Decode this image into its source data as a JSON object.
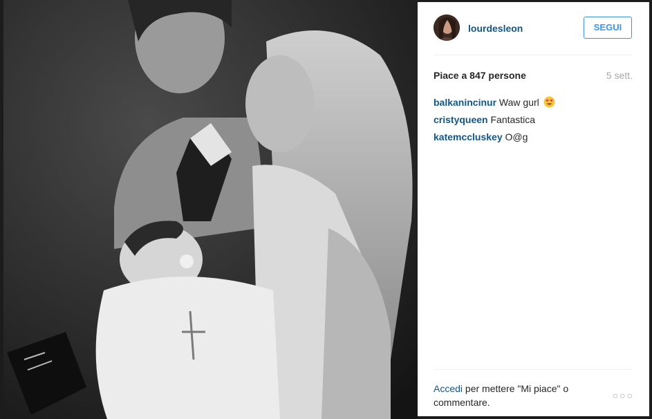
{
  "post": {
    "username": "lourdesleon",
    "follow_label": "SEGUI",
    "likes_text": "Piace a 847 persone",
    "time_ago": "5 sett.",
    "comments": [
      {
        "author": "balkanincinur",
        "text": "Waw gurl"
      },
      {
        "author": "cristyqueen",
        "text": "Fantastica"
      },
      {
        "author": "katemccluskey",
        "text": "O@g"
      }
    ],
    "footer": {
      "login_label": "Accedi",
      "rest_text": "per mettere \"Mi piace\" o commentare."
    },
    "more_label": "○○○"
  },
  "icons": {
    "avatar": "user-avatar",
    "emoji": "heart-eyes-emoji-icon",
    "more": "more-options-icon"
  },
  "colors": {
    "link": "#125688",
    "follow": "#3897f0",
    "muted": "#a5a7aa",
    "text": "#262626"
  }
}
